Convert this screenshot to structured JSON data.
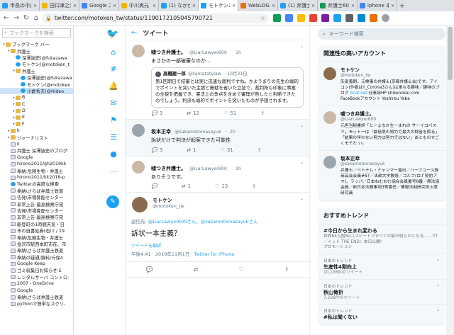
{
  "tabs": [
    {
      "title": "市長の中止",
      "color": "#1da1f2"
    },
    {
      "title": "田口津之介",
      "color": "#f4b400"
    },
    {
      "title": "Google 二ュ",
      "color": "#4285f4"
    },
    {
      "title": "中川爽元",
      "color": "#f4b400"
    },
    {
      "title": "(1) なかが",
      "color": "#1da1f2"
    },
    {
      "title": "モトケンさん",
      "color": "#1da1f2",
      "active": true
    },
    {
      "title": "WebLOG弁",
      "color": "#e8710a"
    },
    {
      "title": "(1) 弁護士",
      "color": "#1da1f2"
    },
    {
      "title": "弁護士60",
      "color": "#0f9d58"
    },
    {
      "title": "iphone 本",
      "color": "#4285f4"
    }
  ],
  "newtab": "+",
  "address": {
    "url": "twitter.com/motoken_tw/status/1190172105045790721"
  },
  "sidebar": {
    "search_placeholder": "ブックマークを検索",
    "items": [
      {
        "label": "ブックマーク バー",
        "kind": "folder",
        "tw": "▾",
        "indent": 0
      },
      {
        "label": "弁護士",
        "kind": "folder",
        "tw": "▾",
        "indent": 1
      },
      {
        "label": "深澤諭史(@fukazawa",
        "kind": "tweet",
        "tw": "",
        "indent": 2
      },
      {
        "label": "モトケン(@motoken_t",
        "kind": "tweet",
        "tw": "",
        "indent": 2
      },
      {
        "label": "弁護士",
        "kind": "folder",
        "tw": "▾",
        "indent": 2
      },
      {
        "label": "深澤諭史(@fukazawa",
        "kind": "tweet",
        "tw": "",
        "indent": 3
      },
      {
        "label": "モトケン(@motoken",
        "kind": "tweet",
        "tw": "",
        "indent": 3
      },
      {
        "label": "小倉秀夫(@Hideo",
        "kind": "tweet",
        "tw": "",
        "indent": 3,
        "selected": true
      },
      {
        "label": "B",
        "kind": "folder",
        "tw": "▸",
        "indent": 2
      },
      {
        "label": "C",
        "kind": "folder",
        "tw": "▸",
        "indent": 2
      },
      {
        "label": "D",
        "kind": "folder",
        "tw": "▸",
        "indent": 2
      },
      {
        "label": "E",
        "kind": "folder",
        "tw": "▸",
        "indent": 2
      },
      {
        "label": "F",
        "kind": "folder",
        "tw": "▸",
        "indent": 2
      },
      {
        "label": "k",
        "kind": "folder",
        "tw": "▸",
        "indent": 1
      },
      {
        "label": "ジャーナリスト",
        "kind": "folder",
        "tw": "▸",
        "indent": 1
      },
      {
        "label": "k",
        "kind": "page",
        "tw": "",
        "indent": 1
      },
      {
        "label": "弁護士 深澤諭史のブログ",
        "kind": "page",
        "tw": "",
        "indent": 1
      },
      {
        "label": "Google",
        "kind": "page",
        "tw": "",
        "indent": 1
      },
      {
        "label": "hirono2011/gh2019kk",
        "kind": "page",
        "tw": "",
        "indent": 1
      },
      {
        "label": "奉納:危険生物・弁護士",
        "kind": "page",
        "tw": "",
        "indent": 1
      },
      {
        "label": "hirono2011/kk2018-p",
        "kind": "page",
        "tw": "",
        "indent": 1
      },
      {
        "label": "Twitterの高度な検索",
        "kind": "tweet",
        "tw": "",
        "indent": 1
      },
      {
        "label": "奉納\\さらば弁護士鉄道",
        "kind": "page",
        "tw": "",
        "indent": 1
      },
      {
        "label": "告発\\市場脅配センター",
        "kind": "page",
        "tw": "",
        "indent": 1
      },
      {
        "label": "非常上告-最高検察庁宛",
        "kind": "page",
        "tw": "",
        "indent": 1
      },
      {
        "label": "告発\\市場脅配センター",
        "kind": "page",
        "tw": "",
        "indent": 1
      },
      {
        "label": "非常上告-最高検察庁宛",
        "kind": "page",
        "tw": "",
        "indent": 1
      },
      {
        "label": "能登町の1時間天気・日",
        "kind": "page",
        "tw": "",
        "indent": 1
      },
      {
        "label": "市の自書処券(石川 / 19",
        "kind": "page",
        "tw": "",
        "indent": 1
      },
      {
        "label": "奉納\\危険生物・弁護士",
        "kind": "page",
        "tw": "",
        "indent": 1
      },
      {
        "label": "金沢市駅西本町市在、市",
        "kind": "page",
        "tw": "",
        "indent": 1
      },
      {
        "label": "奉納\\さらば弁護士鉄道",
        "kind": "page",
        "tw": "",
        "indent": 1
      },
      {
        "label": "奉納の疑通/資料/斤保4",
        "kind": "page",
        "tw": "",
        "indent": 1
      },
      {
        "label": "Google Keep",
        "kind": "page",
        "tw": "",
        "indent": 1
      },
      {
        "label": "ゴミ収集日お知らせ-E",
        "kind": "page",
        "tw": "",
        "indent": 1
      },
      {
        "label": "レンタルサーバ コントロ-",
        "kind": "page",
        "tw": "",
        "indent": 1
      },
      {
        "label": "2007 - OneDrive",
        "kind": "page",
        "tw": "",
        "indent": 1
      },
      {
        "label": "Google",
        "kind": "page",
        "tw": "",
        "indent": 1
      },
      {
        "label": "奉納\\さらば弁護士鉄道",
        "kind": "page",
        "tw": "",
        "indent": 1
      },
      {
        "label": "pythonで簡単なスクリ-",
        "kind": "page",
        "tw": "",
        "indent": 1
      }
    ]
  },
  "nav": {
    "back": "←",
    "forward": "→",
    "reload": "↻",
    "home": "⌂"
  },
  "header": {
    "title": "ツイート",
    "back_icon": "←"
  },
  "tweets": [
    {
      "name": "嘘つき弁護士。",
      "handle": "@LiarLawyer600",
      "time": "1h",
      "text": "まさかの一部破審なのか…",
      "quote": {
        "name": "高橋建一郎",
        "handle": "@kamatatylaw",
        "time": "10月31日",
        "text": "第1回期日で結審とは実に迅速な裁判ですね。かようまりの先生の端的でポイントを突いた主張と無駄を省いた立証で、裁判所も印象に事案の全貌を把握でき、憲法上の争点を含めて審理が熟したと判断できたのでしょう。利決も端的でポイントを突いたものが予想されます。"
      },
      "reply": "3",
      "rt": "12",
      "like": "51"
    },
    {
      "name": "坂本正幸",
      "handle": "@sakamotomasayuk",
      "time": "2h",
      "text": "訴状だけで判決が起案できた可能性",
      "reply": "3",
      "rt": "1",
      "like": "31",
      "hl": true
    },
    {
      "name": "嘘つき弁護士。",
      "handle": "@LiarLawyer600",
      "time": "1h",
      "text": "ありそうです。",
      "reply": "",
      "rt": "1",
      "like": "13"
    }
  ],
  "main_tweet": {
    "name": "モトケン",
    "handle": "@motoken_tw",
    "reply_prefix": "返信先:",
    "reply_to": "@LiarLawyer600さん、@sakamotomasayukさん",
    "text": "訴状一本主義？",
    "translate": "ツイートを翻訳",
    "time": "午後4:41 · 2019年11月1日 · ",
    "client": "Twitter for iPhone"
  },
  "right": {
    "search_placeholder": "キーワード検索",
    "accounts_title": "関連性の高いアカウント",
    "accounts": [
      {
        "name": "モトケン",
        "handle": "@motoken_tw",
        "bio": "矢部善朗。元検事の弁護士(京都弁護士会)です。アイコン(作者はY_Corona3さん)は単なる趣味／趣味のブログ",
        "link": "ltcat.net",
        "bio2": "仕事用HP shikenokai.com FaceBookアカウント Yoshirou Yabe"
      },
      {
        "name": "嘘つき弁護士。",
        "handle": "@LiarLawyer600",
        "bio": "元担当秘書評「とーよなか生一まれの サーイコパスツ」モットーは「最低限の努力で最大の財産を取る」「結果の伴わない努力は努力ではない」あとものすごくモテた い。"
      },
      {
        "name": "坂本正幸",
        "handle": "@sakamotomasayuk",
        "bio": "弁護士／ベトナム・ミャンマー進出／ハーフコース族商品会会員#67／法政大学教授／ゴルフ(ロ.f 契約アマ)、ラッパ／日本ねむおむ協会会員番号8番／無法協会員／新日本法務事項3等委任／情報法制研究所上席研究員"
      }
    ],
    "trends_title": "おすすめトレンド",
    "trends": [
      {
        "cat": "",
        "tag": "#今日から生まれ変わる",
        "desc": "世界64ヵ国No.1スピード!?すべての誕が明らかになる……!!T／イット THE END』本日公開!",
        "promo": "プロモーション"
      },
      {
        "cat": "日本のトレンド",
        "tag": "生産性4割向上",
        "desc": "10,136件のツイート"
      },
      {
        "cat": "日本のトレンド",
        "tag": "秋山脅折",
        "desc": "7,236件のツイート"
      },
      {
        "cat": "日本のトレンド",
        "tag": "#私は聞くない",
        "desc": ""
      }
    ]
  }
}
